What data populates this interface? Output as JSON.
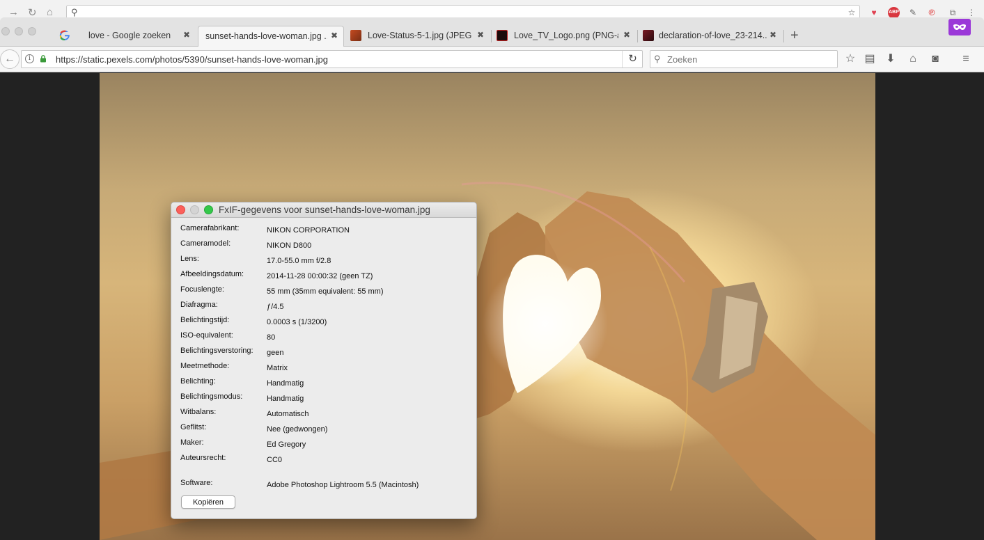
{
  "background_chrome": {
    "omnibox_text": ""
  },
  "tabs": [
    {
      "label": "love - Google zoeken",
      "icon": "google-g-icon",
      "active": false
    },
    {
      "label": "sunset-hands-love-woman.jpg ...",
      "icon": "",
      "active": true
    },
    {
      "label": "Love-Status-5-1.jpg (JPEG...",
      "icon": "image-thumb-icon",
      "active": false
    },
    {
      "label": "Love_TV_Logo.png (PNG-a...",
      "icon": "image-thumb-icon",
      "active": false
    },
    {
      "label": "declaration-of-love_23-214...",
      "icon": "image-thumb-icon",
      "active": false
    }
  ],
  "navbar": {
    "url": "https://static.pexels.com/photos/5390/sunset-hands-love-woman.jpg",
    "search_placeholder": "Zoeken"
  },
  "colors": {
    "private_mask": "#9b38d8",
    "lock_green": "#3a9a3a",
    "close_red": "#fc605b",
    "zoom_green": "#34c84a"
  },
  "dialog": {
    "title": "FxIF-gegevens voor sunset-hands-love-woman.jpg",
    "rows": [
      {
        "label": "Camerafabrikant:",
        "value": "NIKON CORPORATION"
      },
      {
        "label": "Cameramodel:",
        "value": "NIKON D800"
      },
      {
        "label": "Lens:",
        "value": "17.0-55.0 mm f/2.8"
      },
      {
        "label": "Afbeeldingsdatum:",
        "value": "2014-11-28 00:00:32 (geen TZ)"
      },
      {
        "label": "Focuslengte:",
        "value": "55 mm (35mm equivalent: 55 mm)"
      },
      {
        "label": "Diafragma:",
        "value": "ƒ/4.5"
      },
      {
        "label": "Belichtingstijd:",
        "value": "0.0003 s (1/3200)"
      },
      {
        "label": "ISO-equivalent:",
        "value": "80"
      },
      {
        "label": "Belichtingsverstoring:",
        "value": "geen"
      },
      {
        "label": "Meetmethode:",
        "value": "Matrix"
      },
      {
        "label": "Belichting:",
        "value": "Handmatig"
      },
      {
        "label": "Belichtingsmodus:",
        "value": "Handmatig"
      },
      {
        "label": "Witbalans:",
        "value": "Automatisch"
      },
      {
        "label": "Geflitst:",
        "value": "Nee (gedwongen)"
      },
      {
        "label": "Maker:",
        "value": "Ed Gregory"
      },
      {
        "label": "Auteursrecht:",
        "value": "CC0"
      }
    ],
    "software": {
      "label": "Software:",
      "value": "Adobe Photoshop Lightroom 5.5 (Macintosh)"
    },
    "copy_button": "Kopiëren"
  }
}
